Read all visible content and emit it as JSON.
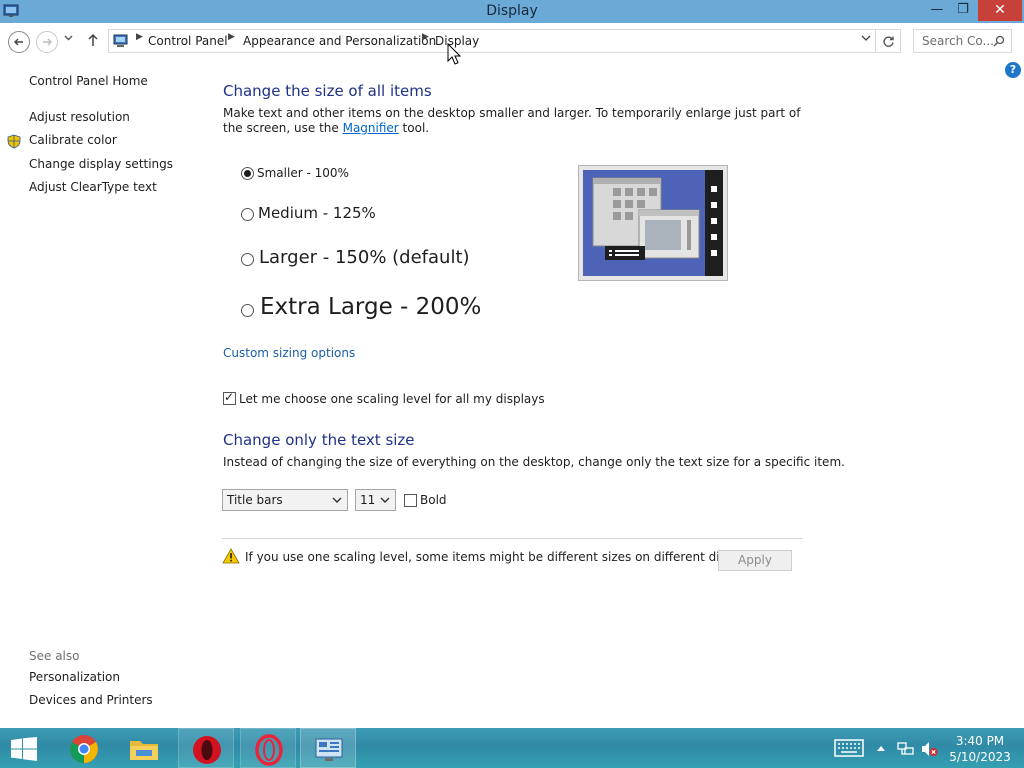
{
  "window": {
    "title": "Display"
  },
  "address": {
    "crumbs": [
      "Control Panel",
      "Appearance and Personalization",
      "Display"
    ],
    "search_placeholder": "Search Co..."
  },
  "sidebar": {
    "home": "Control Panel Home",
    "items": [
      "Adjust resolution",
      "Calibrate color",
      "Change display settings",
      "Adjust ClearType text"
    ],
    "see_also_label": "See also",
    "see_also": [
      "Personalization",
      "Devices and Printers"
    ]
  },
  "main": {
    "heading1": "Change the size of all items",
    "desc1_part1": "Make text and other items on the desktop smaller and larger. To temporarily enlarge just part of the screen, use the ",
    "desc1_link": "Magnifier",
    "desc1_part2": " tool.",
    "options": [
      {
        "label": "Smaller - 100%",
        "checked": true
      },
      {
        "label": "Medium - 125%",
        "checked": false
      },
      {
        "label": "Larger - 150% (default)",
        "checked": false
      },
      {
        "label": "Extra Large - 200%",
        "checked": false
      }
    ],
    "custom_sizing": "Custom sizing options",
    "one_scaling_label": "Let me choose one scaling level for all my displays",
    "one_scaling_checked": true,
    "heading2": "Change only the text size",
    "desc2": "Instead of changing the size of everything on the desktop, change only the text size for a specific item.",
    "item_select": "Title bars",
    "size_select": "11",
    "bold_label": "Bold",
    "bold_checked": false,
    "warning": "If you use one scaling level, some items might be different sizes on different displays.",
    "apply": "Apply"
  },
  "taskbar": {
    "apps": [
      "windows-start-icon",
      "chrome-icon",
      "file-explorer-icon",
      "opera-icon",
      "opera-gx-icon",
      "control-panel-icon"
    ],
    "time": "3:40 PM",
    "date": "5/10/2023"
  },
  "colors": {
    "heading": "#1e3287",
    "link": "#0066cc",
    "titlebar": "#6ba9d6",
    "close": "#c7413a"
  }
}
